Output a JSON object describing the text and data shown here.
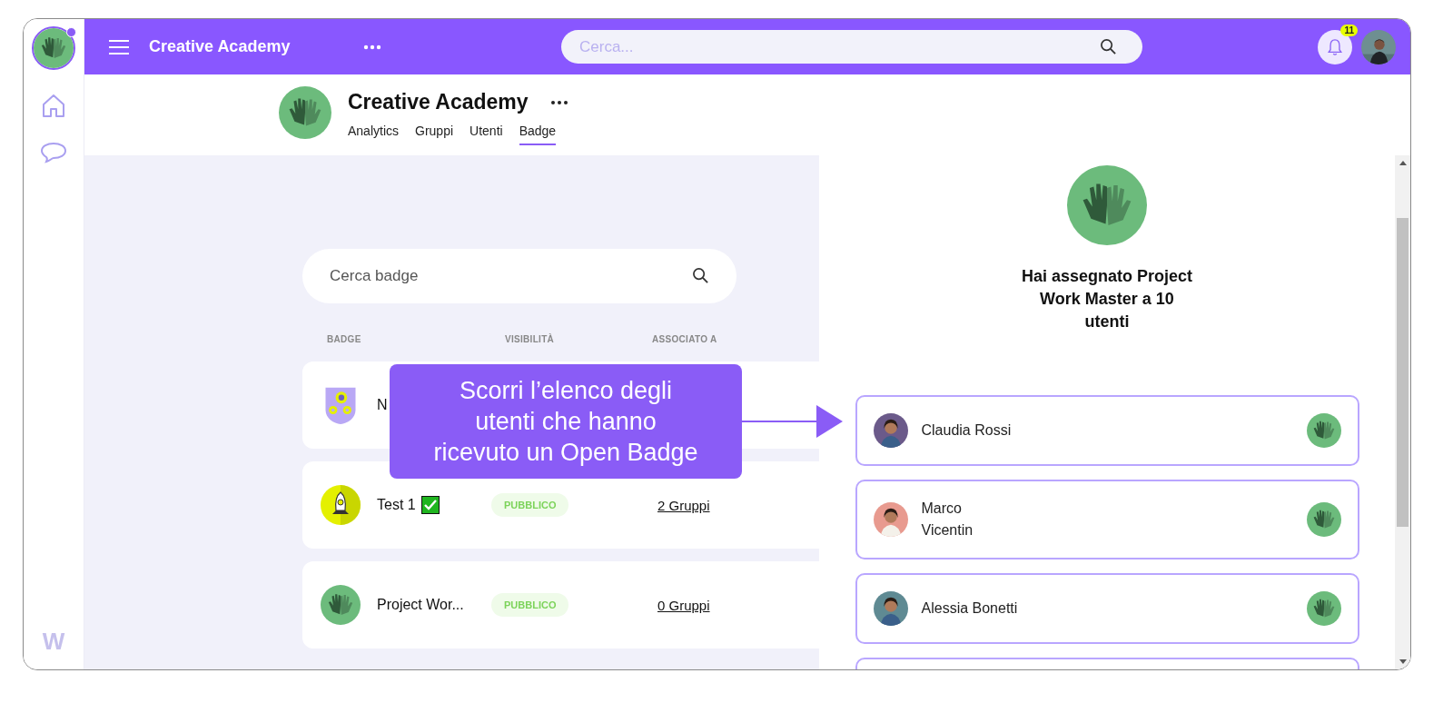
{
  "sidebar": {
    "logo_text": "W",
    "has_alert": true
  },
  "topbar": {
    "title": "Creative Academy",
    "search_placeholder": "Cerca...",
    "notification_count": "11"
  },
  "org": {
    "name": "Creative Academy",
    "tabs": [
      {
        "label": "Analytics",
        "selected": false
      },
      {
        "label": "Gruppi",
        "selected": false
      },
      {
        "label": "Utenti",
        "selected": false
      },
      {
        "label": "Badge",
        "selected": true
      }
    ]
  },
  "badge_search": {
    "placeholder": "Cerca badge"
  },
  "table": {
    "columns": [
      "BADGE",
      "VISIBILITÀ",
      "ASSOCIATO A"
    ],
    "rows": [
      {
        "kind": "gears",
        "name": "N"
      },
      {
        "kind": "rocket",
        "name": "Test 1",
        "checked": true,
        "visibility": "PUBBLICO",
        "associated": "2 Gruppi"
      },
      {
        "kind": "hands",
        "name": "Project Wor...",
        "checked": false,
        "visibility": "PUBBLICO",
        "associated": "0 Gruppi"
      }
    ]
  },
  "callout": {
    "text": "Scorri l’elenco degli\nutenti che hanno\nricevuto un Open Badge"
  },
  "panel": {
    "title": "Hai assegnato Project\nWork Master a 10\nutenti",
    "users": [
      {
        "name": "Claudia Rossi"
      },
      {
        "name": "Marco\nVicentin"
      },
      {
        "name": "Alessia Bonetti"
      }
    ],
    "more_below": true
  }
}
